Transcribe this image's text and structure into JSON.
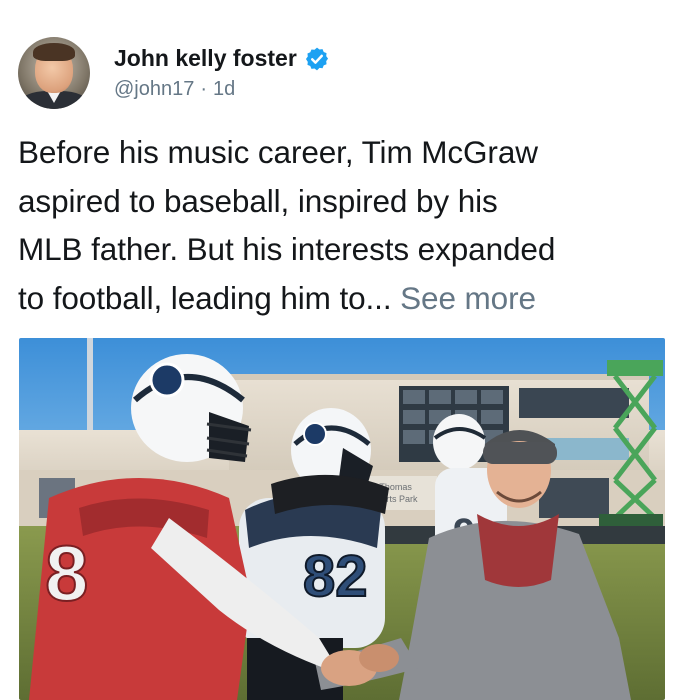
{
  "tweet": {
    "author_name": "John kelly foster",
    "handle": "@john17",
    "separator": "·",
    "age": "1d",
    "text_line1": "Before his music career, Tim McGraw",
    "text_line2": "aspired to baseball, inspired by his",
    "text_line3": "MLB father. But his interests expanded",
    "text_line4": "to football, leading him to...",
    "see_more": "See more"
  },
  "media": {
    "jersey_number_left": "8",
    "jersey_number_middle": "82",
    "sign_line1": "e Thomas",
    "sign_line2": "sports Park"
  },
  "colors": {
    "verified": "#1da1f2",
    "handle_gray": "#657786",
    "text": "#14171a"
  }
}
